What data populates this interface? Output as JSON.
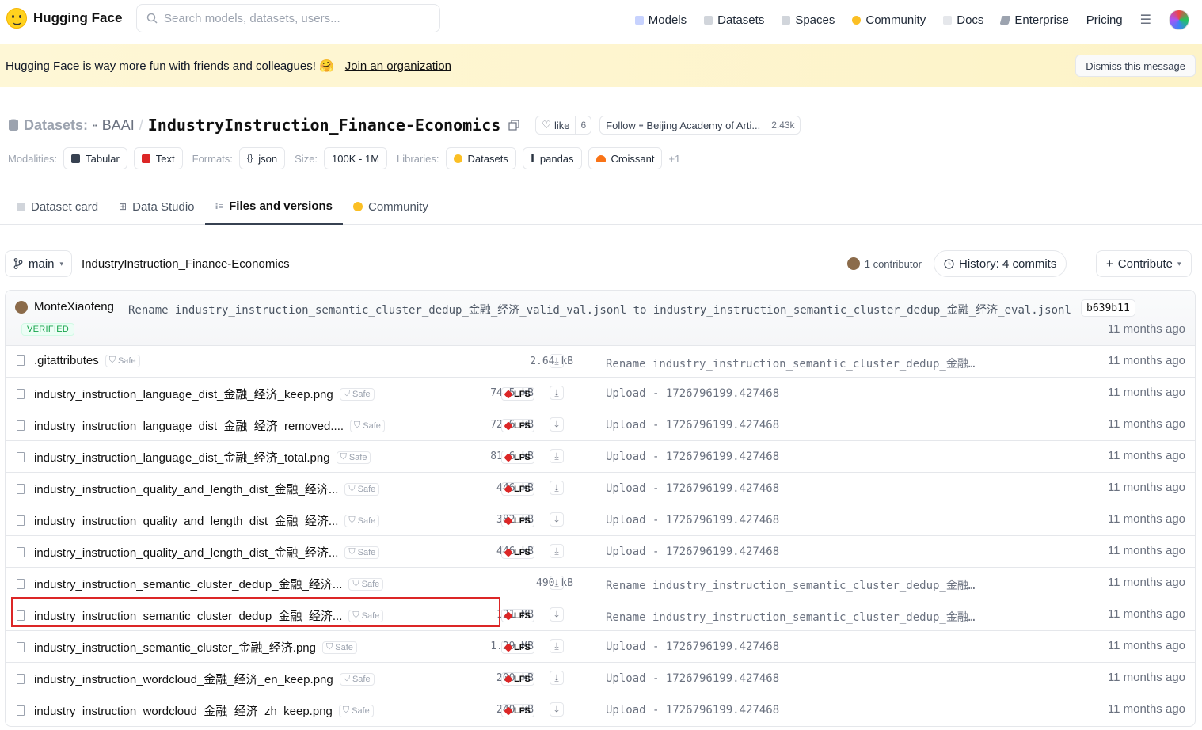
{
  "nav": {
    "brand": "Hugging Face",
    "search_placeholder": "Search models, datasets, users...",
    "links": [
      "Models",
      "Datasets",
      "Spaces",
      "Community",
      "Docs",
      "Enterprise",
      "Pricing"
    ]
  },
  "banner": {
    "message": "Hugging Face is way more fun with friends and colleagues! 🤗",
    "link": "Join an organization",
    "dismiss": "Dismiss this message"
  },
  "header": {
    "section": "Datasets:",
    "org": "BAAI",
    "repo": "IndustryInstruction_Finance-Economics",
    "like_label": "like",
    "like_count": "6",
    "follow_label": "Follow",
    "follow_org": "Beijing Academy of Arti...",
    "follow_count": "2.43k"
  },
  "meta": {
    "modalities_label": "Modalities:",
    "modalities": [
      "Tabular",
      "Text"
    ],
    "formats_label": "Formats:",
    "format": "json",
    "size_label": "Size:",
    "size": "100K - 1M",
    "libraries_label": "Libraries:",
    "libraries": [
      "Datasets",
      "pandas",
      "Croissant"
    ],
    "more": "+1"
  },
  "tabs": [
    "Dataset card",
    "Data Studio",
    "Files and versions",
    "Community"
  ],
  "branchbar": {
    "branch": "main",
    "path": "IndustryInstruction_Finance-Economics",
    "contributors": "1 contributor",
    "history": "History: 4 commits",
    "contribute": "Contribute"
  },
  "last_commit": {
    "author": "MonteXiaofeng",
    "message": "Rename industry_instruction_semantic_cluster_dedup_金融_经济_valid_val.jsonl to industry_instruction_semantic_cluster_dedup_金融_经济_eval.jsonl",
    "sha": "b639b11",
    "verified": "VERIFIED",
    "time": "11 months ago"
  },
  "safe_label": "Safe",
  "lfs_label": "LFS",
  "files": [
    {
      "name": ".gitattributes",
      "size": "2.64 kB",
      "lfs": false,
      "commit": "Rename industry_instruction_semantic_cluster_dedup_金融…",
      "time": "11 months ago"
    },
    {
      "name": "industry_instruction_language_dist_金融_经济_keep.png",
      "size": "74.5 kB",
      "lfs": true,
      "commit": "Upload - 1726796199.427468",
      "time": "11 months ago"
    },
    {
      "name": "industry_instruction_language_dist_金融_经济_removed....",
      "size": "72.6 kB",
      "lfs": true,
      "commit": "Upload - 1726796199.427468",
      "time": "11 months ago"
    },
    {
      "name": "industry_instruction_language_dist_金融_经济_total.png",
      "size": "81.6 kB",
      "lfs": true,
      "commit": "Upload - 1726796199.427468",
      "time": "11 months ago"
    },
    {
      "name": "industry_instruction_quality_and_length_dist_金融_经济...",
      "size": "446 kB",
      "lfs": true,
      "commit": "Upload - 1726796199.427468",
      "time": "11 months ago"
    },
    {
      "name": "industry_instruction_quality_and_length_dist_金融_经济...",
      "size": "382 kB",
      "lfs": true,
      "commit": "Upload - 1726796199.427468",
      "time": "11 months ago"
    },
    {
      "name": "industry_instruction_quality_and_length_dist_金融_经济...",
      "size": "446 kB",
      "lfs": true,
      "commit": "Upload - 1726796199.427468",
      "time": "11 months ago"
    },
    {
      "name": "industry_instruction_semantic_cluster_dedup_金融_经济...",
      "size": "490 kB",
      "lfs": false,
      "commit": "Rename industry_instruction_semantic_cluster_dedup_金融…",
      "time": "11 months ago"
    },
    {
      "name": "industry_instruction_semantic_cluster_dedup_金融_经济...",
      "size": "121 MB",
      "lfs": true,
      "commit": "Rename industry_instruction_semantic_cluster_dedup_金融…",
      "time": "11 months ago"
    },
    {
      "name": "industry_instruction_semantic_cluster_金融_经济.png",
      "size": "1.29 MB",
      "lfs": true,
      "commit": "Upload - 1726796199.427468",
      "time": "11 months ago"
    },
    {
      "name": "industry_instruction_wordcloud_金融_经济_en_keep.png",
      "size": "200 kB",
      "lfs": true,
      "commit": "Upload - 1726796199.427468",
      "time": "11 months ago"
    },
    {
      "name": "industry_instruction_wordcloud_金融_经济_zh_keep.png",
      "size": "240 kB",
      "lfs": true,
      "commit": "Upload - 1726796199.427468",
      "time": "11 months ago"
    }
  ]
}
